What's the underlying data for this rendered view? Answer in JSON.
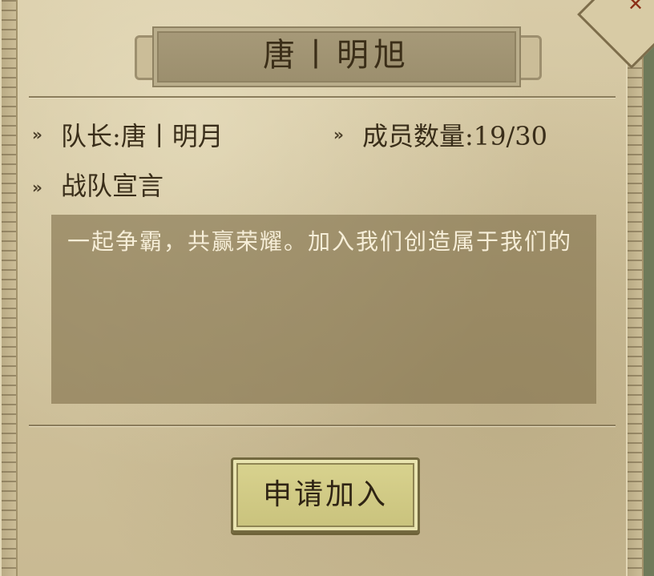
{
  "title": "唐丨明旭",
  "captain": "队长:唐丨明月",
  "members": "成员数量:19/30",
  "declaration_heading": "战队宣言",
  "declaration_text": "一起争霸，共赢荣耀。加入我们创造属于我们的",
  "join_button": "申请加入",
  "bullet_symbol": "»",
  "close_symbol": "✕"
}
